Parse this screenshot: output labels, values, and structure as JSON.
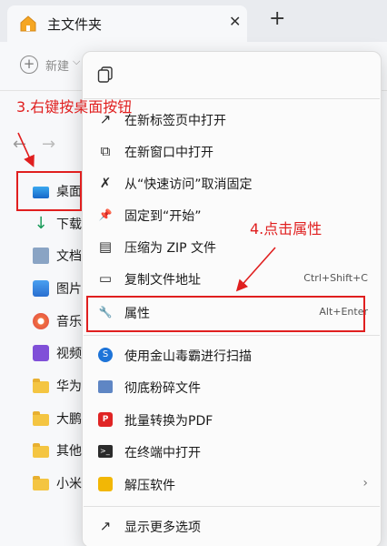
{
  "tab": {
    "title": "主文件夹",
    "close_glyph": "✕",
    "new_tab_glyph": "+"
  },
  "toolbar": {
    "new_label": "新建",
    "new_glyph": "+",
    "new_chevron": "⌵"
  },
  "nav": {
    "back_glyph": "←",
    "forward_glyph": "→",
    "items": [
      {
        "label": "桌面",
        "icon": "desktop-icon"
      },
      {
        "label": "下载",
        "icon": "download-icon"
      },
      {
        "label": "文档",
        "icon": "document-icon"
      },
      {
        "label": "图片",
        "icon": "picture-icon"
      },
      {
        "label": "音乐",
        "icon": "music-icon"
      },
      {
        "label": "视频",
        "icon": "video-icon"
      },
      {
        "label": "华为",
        "icon": "folder-icon"
      },
      {
        "label": "大鹏",
        "icon": "folder-icon"
      },
      {
        "label": "其他",
        "icon": "folder-icon"
      },
      {
        "label": "小米",
        "icon": "folder-icon"
      }
    ]
  },
  "menu": {
    "items": [
      {
        "label": "在新标签页中打开",
        "icon": "open-new-tab-icon",
        "glyph": "↗"
      },
      {
        "label": "在新窗口中打开",
        "icon": "open-new-window-icon",
        "glyph": "⧉"
      },
      {
        "label": "从“快速访问”取消固定",
        "icon": "unpin-icon",
        "glyph": "✗"
      },
      {
        "label": "固定到“开始”",
        "icon": "pin-icon",
        "glyph": "📌"
      },
      {
        "label": "压缩为 ZIP 文件",
        "icon": "zip-icon",
        "glyph": "▤"
      },
      {
        "label": "复制文件地址",
        "icon": "copy-path-icon",
        "glyph": "▭",
        "shortcut": "Ctrl+Shift+C"
      },
      {
        "label": "属性",
        "icon": "wrench-icon",
        "glyph": "🔧",
        "shortcut": "Alt+Enter"
      },
      {
        "label": "使用金山毒霸进行扫描",
        "icon": "kingsoft-scan-icon",
        "glyph": "S"
      },
      {
        "label": "彻底粉碎文件",
        "icon": "shred-icon",
        "glyph": ""
      },
      {
        "label": "批量转换为PDF",
        "icon": "pdf-icon",
        "glyph": "P"
      },
      {
        "label": "在终端中打开",
        "icon": "terminal-icon",
        "glyph": ">_"
      },
      {
        "label": "解压软件",
        "icon": "unzip-icon",
        "glyph": "",
        "submenu_glyph": "›"
      },
      {
        "label": "显示更多选项",
        "icon": "more-options-icon",
        "glyph": "↗"
      }
    ]
  },
  "annotations": {
    "step3": "3.右键按桌面按钮",
    "step4": "4.点击属性"
  },
  "colors": {
    "annotation": "#e01f1f",
    "accent": "#1e74d8"
  }
}
